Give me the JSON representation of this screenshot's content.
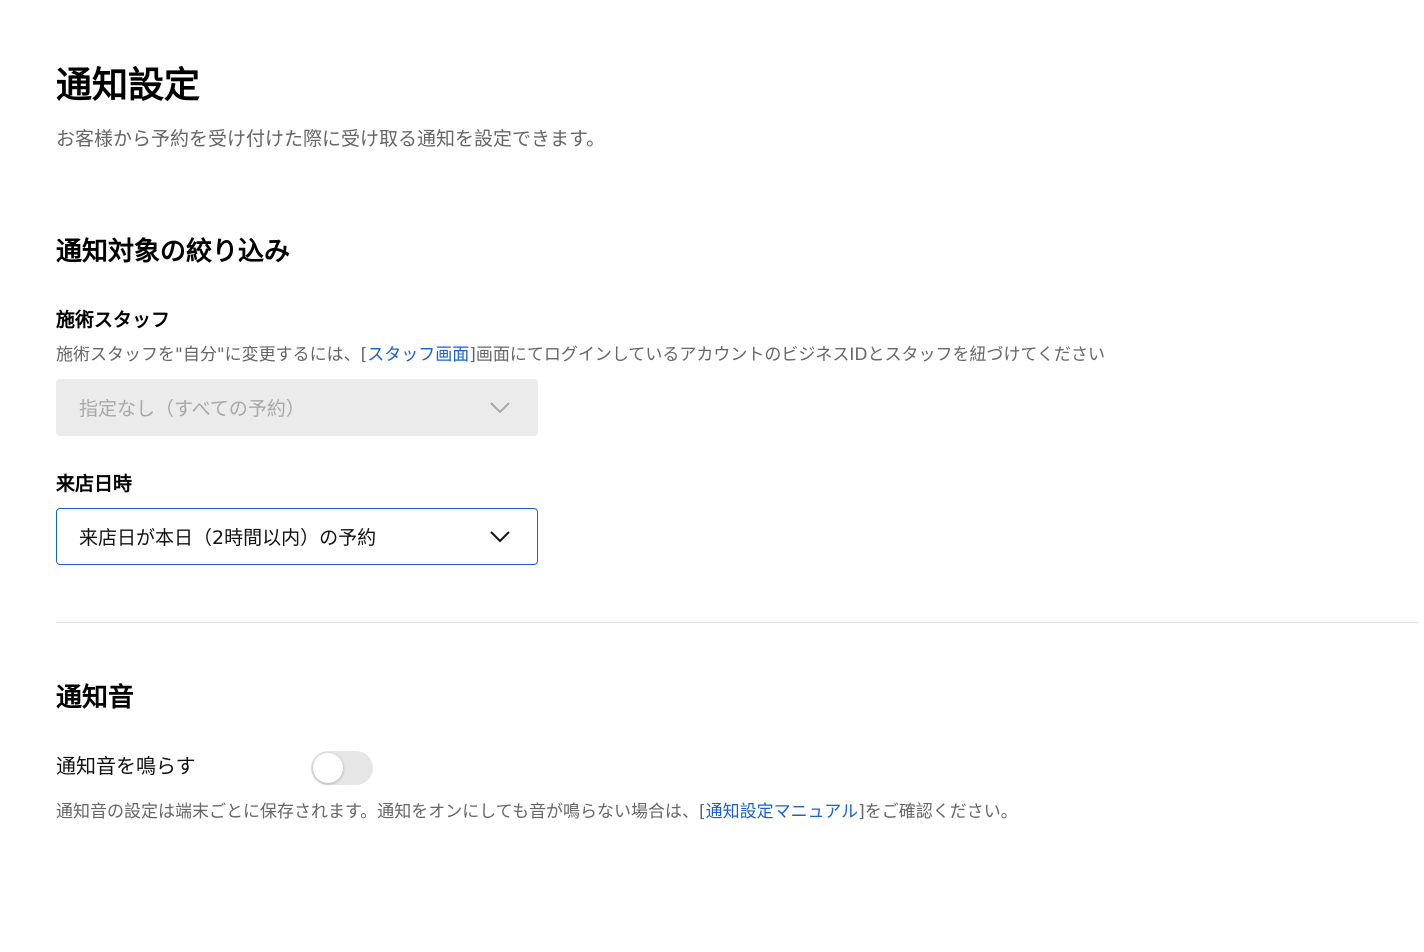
{
  "page": {
    "title": "通知設定",
    "subtitle": "お客様から予約を受け付けた際に受け取る通知を設定できます。"
  },
  "filter_section": {
    "title": "通知対象の絞り込み",
    "staff": {
      "label": "施術スタッフ",
      "helper_before": "施術スタッフを\"自分\"に変更するには、[",
      "helper_link": "スタッフ画面",
      "helper_after": "]画面にてログインしているアカウントのビジネスIDとスタッフを紐づけてください",
      "select_value": "指定なし（すべての予約）",
      "disabled": true
    },
    "visit": {
      "label": "来店日時",
      "select_value": "来店日が本日（2時間以内）の予約"
    }
  },
  "sound_section": {
    "title": "通知音",
    "toggle_label": "通知音を鳴らす",
    "toggle_on": false,
    "helper_before": "通知音の設定は端末ごとに保存されます。通知をオンにしても音が鳴らない場合は、[",
    "helper_link": "通知設定マニュアル",
    "helper_after": "]をご確認ください。"
  },
  "colors": {
    "link": "#1a5fd6",
    "focus_border": "#1a5fd6",
    "disabled_bg": "#ebebeb",
    "toggle_off": "#e6e6e6"
  },
  "icons": {
    "select_chevron": "chevron-down-icon"
  }
}
